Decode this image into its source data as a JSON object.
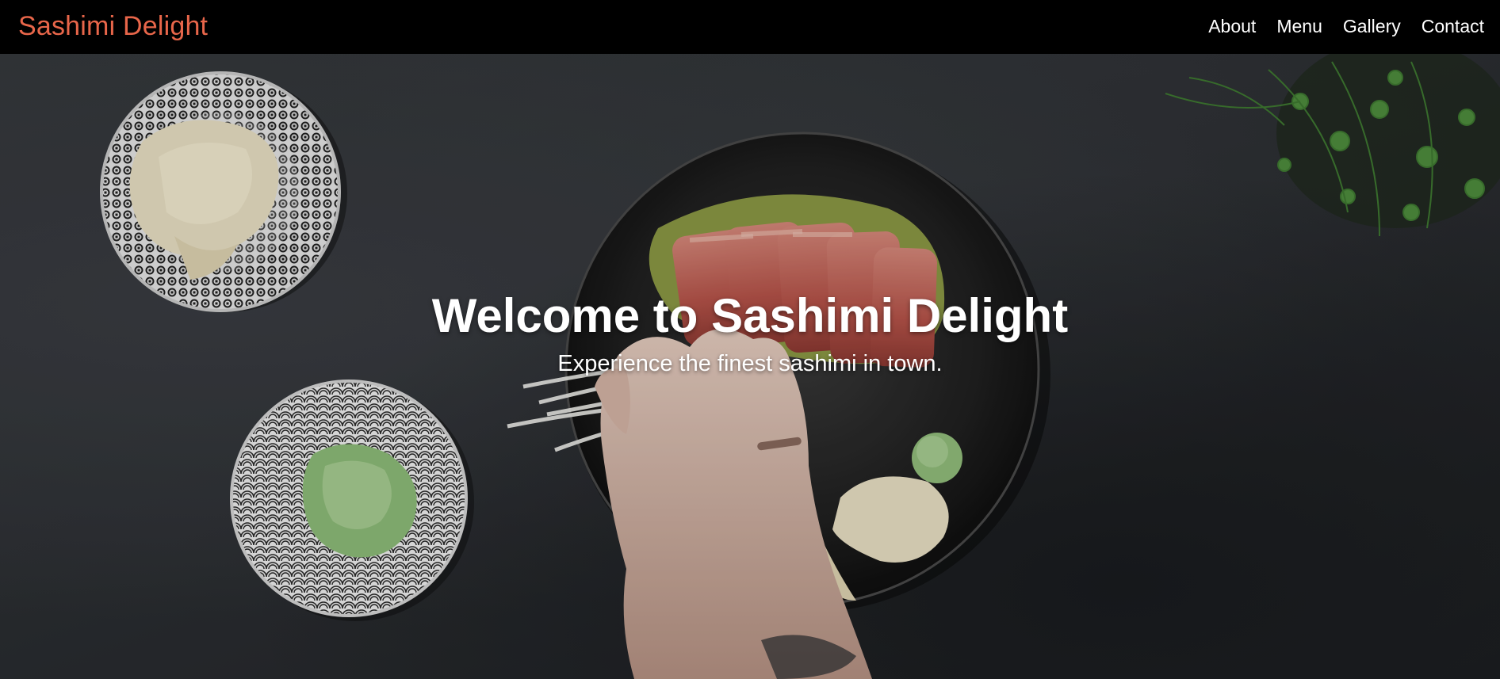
{
  "nav": {
    "brand": "Sashimi Delight",
    "brand_color": "#e8664a",
    "links": [
      {
        "label": "About"
      },
      {
        "label": "Menu"
      },
      {
        "label": "Gallery"
      },
      {
        "label": "Contact"
      }
    ]
  },
  "hero": {
    "title": "Welcome to Sashimi Delight",
    "subtitle": "Experience the finest sashimi in town.",
    "background": "overhead-sashimi-plating-photo"
  }
}
